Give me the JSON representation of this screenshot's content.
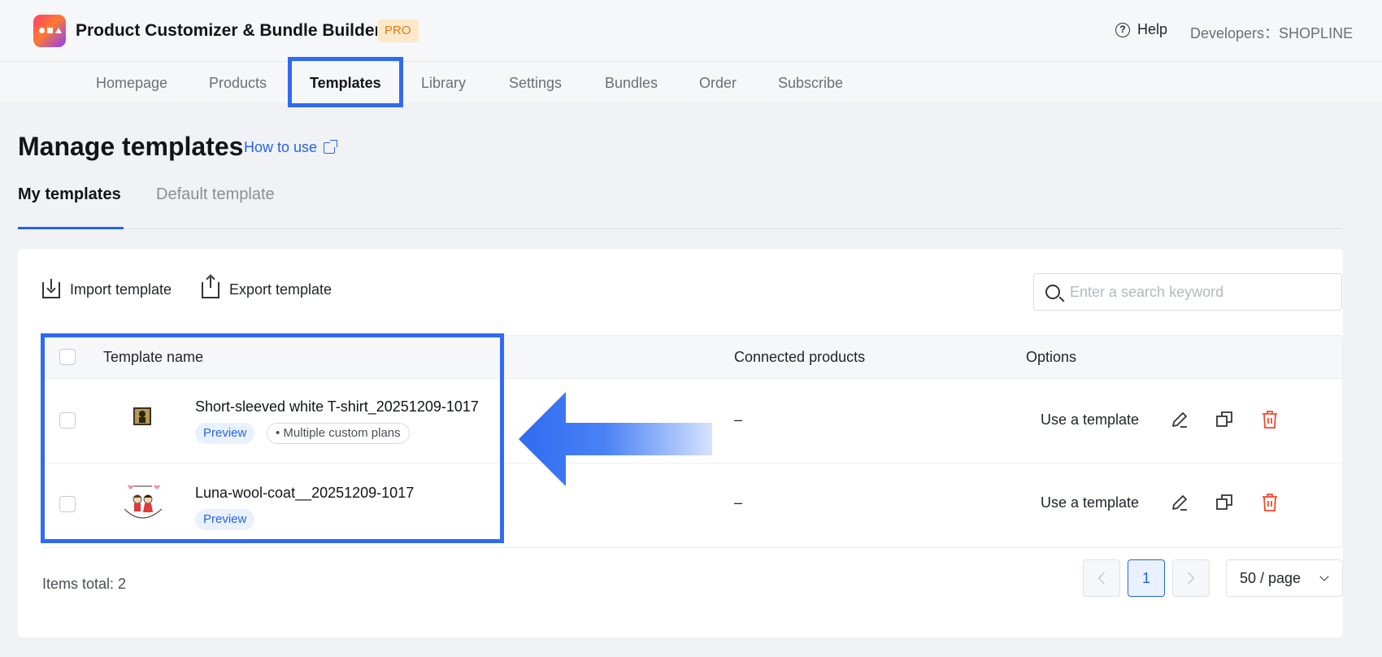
{
  "header": {
    "app_title": "Product Customizer & Bundle Builder",
    "badge": "PRO",
    "help_label": "Help",
    "developers": "Developers：SHOPLINE"
  },
  "nav": {
    "items": [
      "Homepage",
      "Products",
      "Templates",
      "Library",
      "Settings",
      "Bundles",
      "Order",
      "Subscribe"
    ],
    "active": "Templates"
  },
  "page": {
    "title": "Manage templates",
    "how_to_use": "How to use"
  },
  "tabs": {
    "my_templates": "My templates",
    "default_template": "Default template",
    "active": "My templates"
  },
  "toolbar": {
    "import_label": "Import template",
    "export_label": "Export template",
    "search_placeholder": "Enter a search keyword"
  },
  "table": {
    "columns": {
      "name": "Template name",
      "connected": "Connected products",
      "options": "Options"
    },
    "rows": [
      {
        "name": "Short-sleeved white T-shirt_20251209-1017",
        "preview": "Preview",
        "plan_tag": "• Multiple custom plans",
        "connected": "–",
        "use_label": "Use a template"
      },
      {
        "name": "Luna-wool-coat__20251209-1017",
        "preview": "Preview",
        "connected": "–",
        "use_label": "Use a template"
      }
    ]
  },
  "footer": {
    "total": "Items total: 2",
    "current_page": "1",
    "page_size": "50 / page"
  },
  "colors": {
    "accent": "#2563eb",
    "highlight_box": "#2f6bf2",
    "delete": "#f04a2c",
    "badge_bg": "#fde9c9",
    "badge_text": "#e07b14"
  }
}
